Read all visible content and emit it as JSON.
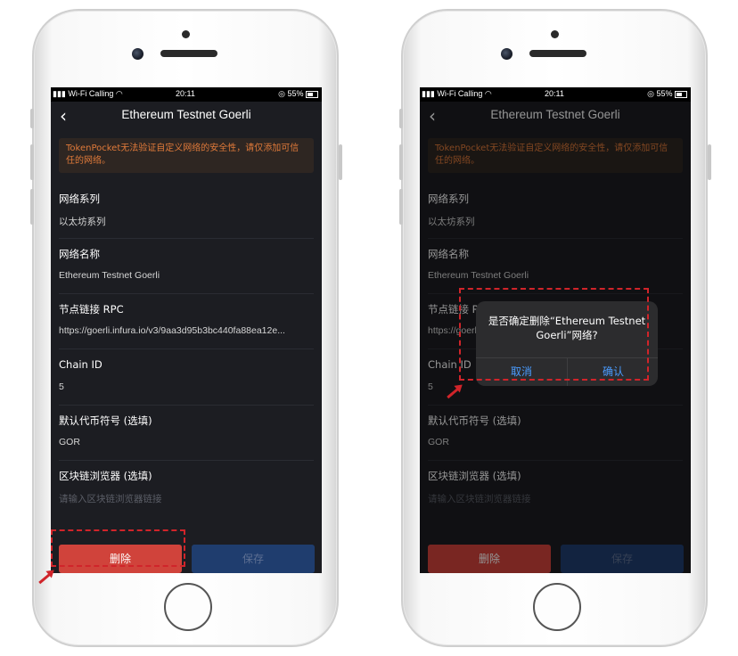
{
  "status_bar": {
    "carrier": "Wi-Fi Calling",
    "time": "20:11",
    "battery": "55%"
  },
  "nav": {
    "back_glyph": "‹",
    "title": "Ethereum Testnet Goerli"
  },
  "warning_text": "TokenPocket无法验证自定义网络的安全性，请仅添加可信任的网络。",
  "fields": [
    {
      "label": "网络系列",
      "value": "以太坊系列"
    },
    {
      "label": "网络名称",
      "value": "Ethereum Testnet Goerli"
    },
    {
      "label": "节点链接 RPC",
      "value": "https://goerli.infura.io/v3/9aa3d95b3bc440fa88ea12e..."
    },
    {
      "label": "Chain ID",
      "value": "5"
    },
    {
      "label": "默认代币符号 (选填)",
      "value": "GOR"
    },
    {
      "label": "区块链浏览器 (选填)",
      "placeholder": "请输入区块链浏览器链接"
    }
  ],
  "buttons": {
    "delete": "删除",
    "save": "保存"
  },
  "dialog": {
    "message": "是否确定删除“Ethereum Testnet Goerli”网络?",
    "cancel": "取消",
    "confirm": "确认"
  },
  "colors": {
    "screen_bg": "#1c1d22",
    "delete_red": "#d0433b",
    "save_blue": "#1f3d6e",
    "warning_orange": "#e07a3a",
    "highlight_red": "#d0242a",
    "dialog_link": "#4a9cff"
  }
}
